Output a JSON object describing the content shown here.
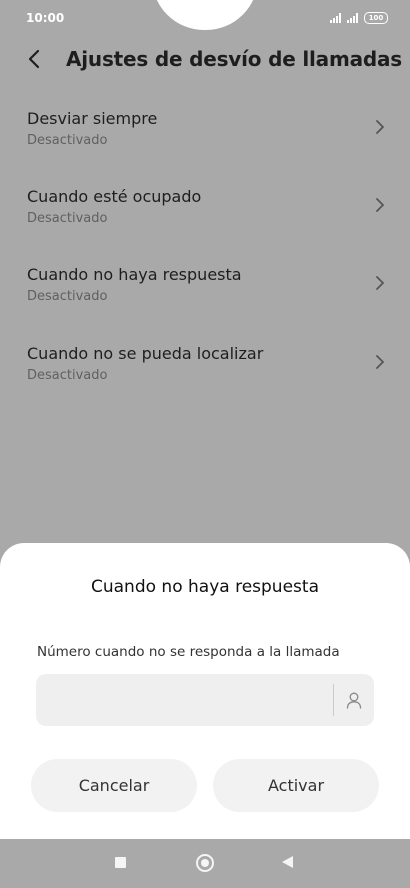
{
  "status_bar": {
    "time": "10:00",
    "battery": "100"
  },
  "header": {
    "title": "Ajustes de desvío de llamadas",
    "back_icon": "back-arrow-icon"
  },
  "list": {
    "items": [
      {
        "title": "Desviar siempre",
        "status": "Desactivado"
      },
      {
        "title": "Cuando esté ocupado",
        "status": "Desactivado"
      },
      {
        "title": "Cuando no haya respuesta",
        "status": "Desactivado"
      },
      {
        "title": "Cuando no se pueda localizar",
        "status": "Desactivado"
      }
    ]
  },
  "dialog": {
    "title": "Cuando no haya respuesta",
    "field_label": "Número cuando no se responda a la llamada",
    "field_value": "",
    "contact_icon": "contact-person-icon",
    "cancel_label": "Cancelar",
    "activate_label": "Activar"
  },
  "colors": {
    "overlay": "#a9a9a9",
    "sheet": "#ffffff",
    "button_bg": "#f2f2f2"
  }
}
